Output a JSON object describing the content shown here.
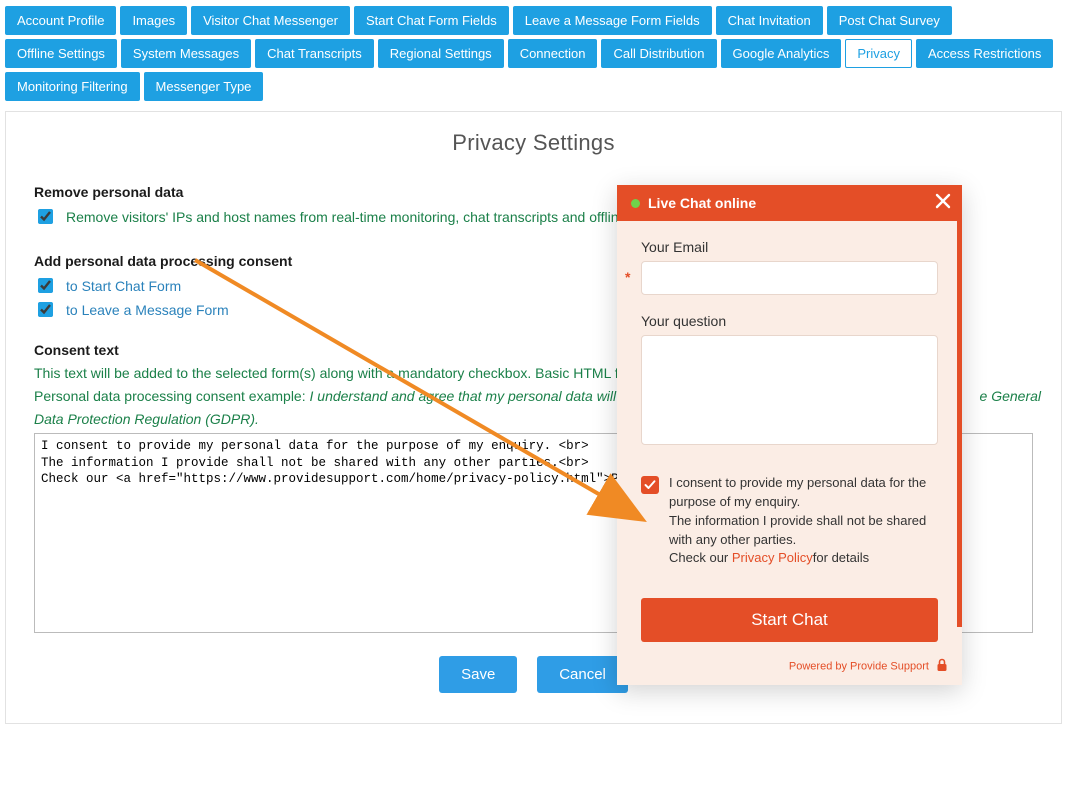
{
  "nav": {
    "row1": [
      "Account Profile",
      "Images",
      "Visitor Chat Messenger",
      "Start Chat Form Fields",
      "Leave a Message Form Fields",
      "Chat Invitation",
      "Post Chat Survey",
      "Offline Settings",
      "System Messages"
    ],
    "row2": [
      "Chat Transcripts",
      "Regional Settings",
      "Connection",
      "Call Distribution",
      "Google Analytics",
      "Privacy",
      "Access Restrictions",
      "Monitoring Filtering",
      "Messenger Type"
    ],
    "active": "Privacy"
  },
  "page": {
    "title": "Privacy Settings",
    "remove_h": "Remove personal data",
    "remove_opt": "Remove visitors' IPs and host names from real-time monitoring, chat transcripts and offline",
    "consent_h": "Add personal data processing consent",
    "opt_start": "to Start Chat Form",
    "opt_leave": "to Leave a Message Form",
    "consent_text_h": "Consent text",
    "consent_desc1": "This text will be added to the selected form(s) along with a mandatory checkbox. Basic HTML form",
    "consent_desc2a": "Personal data processing consent example: ",
    "consent_desc2b": "I understand and agree that my personal data will be",
    "consent_desc2c_right": "e General",
    "consent_desc3": "Data Protection Regulation (GDPR).",
    "textarea": "I consent to provide my personal data for the purpose of my enquiry. <br>\nThe information I provide shall not be shared with any other parties.<br>\nCheck our <a href=\"https://www.providesupport.com/home/privacy-policy.html\">Privacy Polic",
    "save": "Save",
    "cancel": "Cancel"
  },
  "chat": {
    "title": "Live Chat online",
    "email_label": "Your Email",
    "question_label": "Your question",
    "consent_l1": "I consent to provide my personal data for the purpose of my enquiry.",
    "consent_l2": "The information I provide shall not be shared with any other parties.",
    "consent_l3a": "Check our ",
    "consent_link": "Privacy Policy",
    "consent_l3b": "for details",
    "start": "Start Chat",
    "footer": "Powered by Provide Support"
  }
}
